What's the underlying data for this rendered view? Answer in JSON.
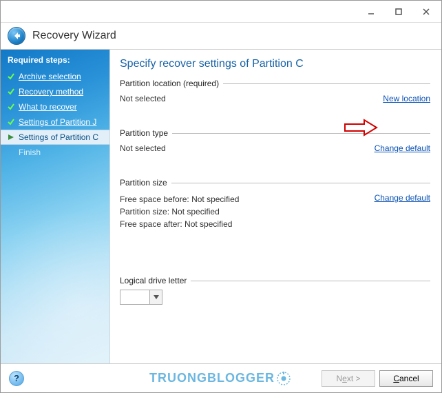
{
  "header": {
    "title": "Recovery Wizard"
  },
  "sidebar": {
    "heading": "Required steps:",
    "steps": [
      {
        "label": "Archive selection",
        "state": "done"
      },
      {
        "label": "Recovery method",
        "state": "done"
      },
      {
        "label": "What to recover",
        "state": "done"
      },
      {
        "label": "Settings of Partition J",
        "state": "done"
      },
      {
        "label": "Settings of Partition C",
        "state": "current"
      },
      {
        "label": "Finish",
        "state": "pending"
      }
    ]
  },
  "main": {
    "title": "Specify recover settings of Partition C",
    "loc": {
      "heading": "Partition location (required)",
      "value": "Not selected",
      "action": "New location"
    },
    "ptype": {
      "heading": "Partition type",
      "value": "Not selected",
      "action": "Change default"
    },
    "psize": {
      "heading": "Partition size",
      "free_before_k": "Free space before",
      "free_before_v": "Not specified",
      "size_k": "Partition size",
      "size_v": "Not specified",
      "free_after_k": "Free space after",
      "free_after_v": "Not specified",
      "action": "Change default"
    },
    "letter": {
      "heading": "Logical drive letter",
      "value": ""
    }
  },
  "buttons": {
    "next_pre": "N",
    "next_u": "e",
    "next_post": "xt >",
    "cancel_pre": "",
    "cancel_u": "C",
    "cancel_post": "ancel"
  },
  "watermark": "TRUONGBLOGGER"
}
